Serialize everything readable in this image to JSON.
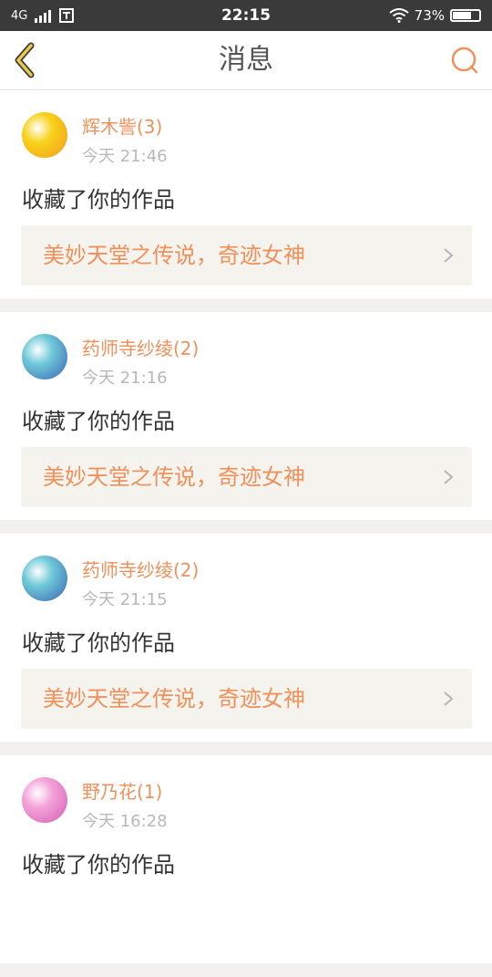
{
  "status_bar": {
    "network": "4G",
    "time": "22:15",
    "battery_percent": "73%",
    "battery_level": 0.73,
    "icons": [
      "signal-icon",
      "sim-icon",
      "wifi-icon",
      "battery-icon"
    ]
  },
  "nav": {
    "title": "消息",
    "back_icon": "chevron-left-icon",
    "search_icon": "search-icon",
    "accent_color": "#f0905a"
  },
  "messages": [
    {
      "user": "辉木訾(3)",
      "time": "今天 21:46",
      "action": "收藏了你的作品",
      "work": "美妙天堂之传说，奇迹女神",
      "avatar_colors": [
        "#f7d21a",
        "#f59a1c"
      ]
    },
    {
      "user": "药师寺纱绫(2)",
      "time": "今天 21:16",
      "action": "收藏了你的作品",
      "work": "美妙天堂之传说，奇迹女神",
      "avatar_colors": [
        "#6fc9d8",
        "#3a63b3"
      ]
    },
    {
      "user": "药师寺纱绫(2)",
      "time": "今天 21:15",
      "action": "收藏了你的作品",
      "work": "美妙天堂之传说，奇迹女神",
      "avatar_colors": [
        "#6fc9d8",
        "#3a63b3"
      ]
    },
    {
      "user": "野乃花(1)",
      "time": "今天 16:28",
      "action": "收藏了你的作品",
      "work": "",
      "avatar_colors": [
        "#f4a3d8",
        "#d35bb5"
      ]
    }
  ]
}
